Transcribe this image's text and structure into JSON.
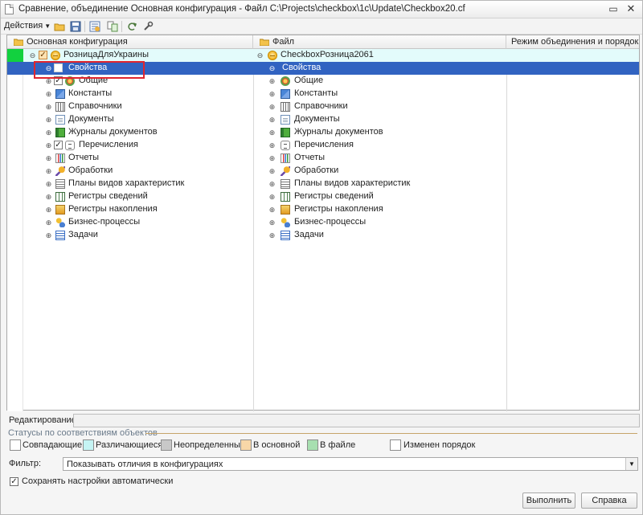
{
  "window": {
    "title": "Сравнение, объединение Основная конфигурация - Файл C:\\Projects\\checkbox\\1c\\Update\\Checkbox20.cf"
  },
  "toolbar": {
    "actions_label": "Действия",
    "icons": [
      "open-icon",
      "save-icon",
      "settings-icon",
      "compare-icon",
      "refresh-icon",
      "tools-icon"
    ]
  },
  "columns": {
    "main_config": "Основная конфигурация",
    "file": "Файл",
    "merge_mode": "Режим объединения и порядок п..."
  },
  "tree": {
    "root_left": "РозницаДляУкраины",
    "root_right": "CheckboxРозница2061",
    "selected_row": "Свойства",
    "items": [
      {
        "label": "Свойства",
        "icon": "properties-icon",
        "checked": false
      },
      {
        "label": "Общие",
        "icon": "common-icon",
        "checked": true
      },
      {
        "label": "Константы",
        "icon": "constants-icon"
      },
      {
        "label": "Справочники",
        "icon": "catalogs-icon"
      },
      {
        "label": "Документы",
        "icon": "documents-icon"
      },
      {
        "label": "Журналы документов",
        "icon": "document-journals-icon"
      },
      {
        "label": "Перечисления",
        "icon": "enums-icon",
        "checked": true
      },
      {
        "label": "Отчеты",
        "icon": "reports-icon"
      },
      {
        "label": "Обработки",
        "icon": "data-processors-icon"
      },
      {
        "label": "Планы видов характеристик",
        "icon": "characteristic-plans-icon"
      },
      {
        "label": "Регистры сведений",
        "icon": "info-registers-icon"
      },
      {
        "label": "Регистры накопления",
        "icon": "accumulation-registers-icon"
      },
      {
        "label": "Бизнес-процессы",
        "icon": "business-processes-icon"
      },
      {
        "label": "Задачи",
        "icon": "tasks-icon"
      }
    ]
  },
  "editing": {
    "label": "Редактирование:",
    "value": ""
  },
  "statuses": {
    "group_title": "Статусы по соответствиям объектов",
    "items": [
      {
        "label": "Совпадающие",
        "color": "#ffffff"
      },
      {
        "label": "Различающиеся",
        "color": "#c5f4f4"
      },
      {
        "label": "Неопределенные",
        "color": "#c8c8c8"
      },
      {
        "label": "В основной",
        "color": "#f8d7a8"
      },
      {
        "label": "В файле",
        "color": "#a7dfb0"
      },
      {
        "label": "Изменен порядок",
        "color": "#ffffff"
      }
    ]
  },
  "filter": {
    "label": "Фильтр:",
    "value": "Показывать отличия в конфигурациях"
  },
  "settings": {
    "save_auto_label": "Сохранять настройки автоматически",
    "save_auto_checked": true
  },
  "buttons": {
    "run": "Выполнить",
    "help": "Справка"
  },
  "colors": {
    "selection": "#3163c1",
    "root_row": "#e3fbfb",
    "status_marker": "#12d13f",
    "highlight_box": "#e0252e"
  }
}
